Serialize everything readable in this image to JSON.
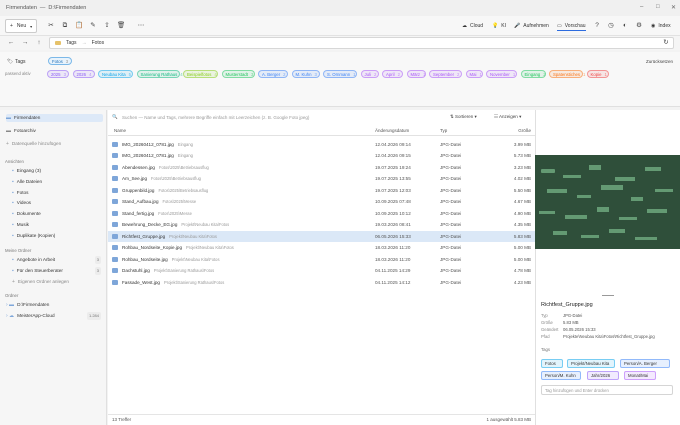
{
  "titlebar": {
    "app": "Firmendaten",
    "path": "D:\\Firmendaten"
  },
  "toolbar": {
    "new_label": "Neu",
    "cloud": "Cloud",
    "ki": "KI",
    "aufnehmen": "Aufnehmen",
    "vorschau": "Vorschau",
    "index": "Index"
  },
  "path": {
    "seg1": "Tags",
    "sep": "→",
    "seg2": "Fotos"
  },
  "tags": {
    "label": "Tags",
    "passend": "passend aktiv",
    "zuruecksetzen": "Zurücksetzen",
    "top": [
      {
        "label": "Fotos",
        "count": "3"
      }
    ],
    "chips": [
      {
        "label": "2025",
        "count": "3",
        "color": "#8b5cf6"
      },
      {
        "label": "2026",
        "count": "4",
        "color": "#8b5cf6"
      },
      {
        "label": "Neubau Kita",
        "count": "5",
        "color": "#0ea5e9"
      },
      {
        "label": "Sanierung Rathaus",
        "count": "4",
        "color": "#10b981"
      },
      {
        "label": "Beispielfotos",
        "count": "4",
        "color": "#84cc16"
      },
      {
        "label": "Musterstadt",
        "count": "3",
        "color": "#22c55e"
      },
      {
        "label": "A. Berger",
        "count": "2",
        "color": "#3b82f6"
      },
      {
        "label": "M. Kuhn",
        "count": "3",
        "color": "#3b82f6"
      },
      {
        "label": "S. Ornmann",
        "count": "1",
        "color": "#3b82f6"
      },
      {
        "label": "Juli",
        "count": "2",
        "color": "#a855f7"
      },
      {
        "label": "April",
        "count": "2",
        "color": "#a855f7"
      },
      {
        "label": "März",
        "count": "1",
        "color": "#a855f7"
      },
      {
        "label": "September",
        "count": "2",
        "color": "#a855f7"
      },
      {
        "label": "Mai",
        "count": "1",
        "color": "#a855f7"
      },
      {
        "label": "November",
        "count": "1",
        "color": "#a855f7"
      },
      {
        "label": "Eingang",
        "count": "2",
        "color": "#22c55e"
      },
      {
        "label": "Spatenstiches",
        "count": "1",
        "color": "#f97316"
      },
      {
        "label": "Kopie",
        "count": "1",
        "color": "#ef4444"
      }
    ]
  },
  "sidebar": {
    "roots": [
      {
        "label": "Firmendaten"
      },
      {
        "label": "Fotoarchiv"
      }
    ],
    "add_source": "Datenquelle hinzufügen",
    "ansichten_title": "Ansichten",
    "ansichten": [
      {
        "label": "Eingang (3)"
      },
      {
        "label": "Alle Dateien"
      },
      {
        "label": "Fotos"
      },
      {
        "label": "Videos"
      },
      {
        "label": "Dokumente"
      },
      {
        "label": "Musik"
      },
      {
        "label": "Duplikate (Kopien)"
      }
    ],
    "meine_title": "Meine Ordner",
    "meine": [
      {
        "label": "Angebote in Arbeit",
        "count": "3"
      },
      {
        "label": "Für den Steuerberater",
        "count": "3"
      }
    ],
    "add_folder": "Eigenen Ordner anlegen",
    "ordner_title": "Ordner",
    "ordner": [
      {
        "label": "D:\\Firmendaten",
        "count": ""
      },
      {
        "label": "MeisterApp-Cloud",
        "count": "1.284"
      }
    ]
  },
  "main": {
    "search_placeholder": "Suchen — Name und Tags, mehrere Begriffe einfach mit Leerzeichen (z. B. Google Foto jpeg)",
    "sort": "Sortieren",
    "view": "Anzeigen",
    "cols": {
      "name": "Name",
      "date": "Änderungsdatum",
      "type": "Typ",
      "size": "Größe"
    },
    "rows": [
      {
        "name": "IMG_20260412_0781.jpg",
        "sub": "Eingang",
        "date": "12.04.2026 09:14",
        "type": "JPG-Datei",
        "size": "3.99 MB"
      },
      {
        "name": "IMG_20260412_0781.jpg",
        "sub": "Eingang",
        "date": "12.04.2026 09:15",
        "type": "JPG-Datei",
        "size": "5.73 MB"
      },
      {
        "name": "Abendessen.jpg",
        "sub": "Fotos\\2025\\Betriebsausflug",
        "date": "19.07.2025 19:24",
        "type": "JPG-Datei",
        "size": "3.23 MB"
      },
      {
        "name": "Am_See.jpg",
        "sub": "Fotos\\2025\\Betriebsausflug",
        "date": "19.07.2025 13:55",
        "type": "JPG-Datei",
        "size": "4.02 MB"
      },
      {
        "name": "Gruppenbild.jpg",
        "sub": "Fotos\\2025\\Betriebsausflug",
        "date": "19.07.2025 12:03",
        "type": "JPG-Datei",
        "size": "5.50 MB"
      },
      {
        "name": "Stand_Aufbau.jpg",
        "sub": "Fotos\\2025\\Messe",
        "date": "10.09.2025 07:48",
        "type": "JPG-Datei",
        "size": "4.67 MB"
      },
      {
        "name": "Stand_fertig.jpg",
        "sub": "Fotos\\2025\\Messe",
        "date": "10.09.2025 10:12",
        "type": "JPG-Datei",
        "size": "4.90 MB"
      },
      {
        "name": "Bewehrung_Decke_EG.jpg",
        "sub": "Projekt\\Neubau Kita\\Fotos",
        "date": "19.03.2026 08:41",
        "type": "JPG-Datei",
        "size": "4.35 MB"
      },
      {
        "name": "Richtfest_Gruppe.jpg",
        "sub": "Projekt\\Neubau Kita\\Fotos",
        "date": "06.05.2026 15:33",
        "type": "JPG-Datei",
        "size": "5.83 MB"
      },
      {
        "name": "Rohbau_Nordseite_Kopie.jpg",
        "sub": "Projekt\\Neubau Kita\\Fotos",
        "date": "18.03.2026 11:20",
        "type": "JPG-Datei",
        "size": "5.00 MB"
      },
      {
        "name": "Rohbau_Nordseite.jpg",
        "sub": "Projekt\\Neubau Kita\\Fotos",
        "date": "18.03.2026 11:20",
        "type": "JPG-Datei",
        "size": "5.00 MB"
      },
      {
        "name": "Dachstuhl.jpg",
        "sub": "Projekt\\Sanierung Rathaus\\Fotos",
        "date": "04.11.2025 14:29",
        "type": "JPG-Datei",
        "size": "4.78 MB"
      },
      {
        "name": "Fassade_West.jpg",
        "sub": "Projekt\\Sanierung Rathaus\\Fotos",
        "date": "04.11.2025 14:12",
        "type": "JPG-Datei",
        "size": "4.23 MB"
      }
    ],
    "status_left": "13 Treffer",
    "status_right": "1 ausgewählt 5.83 MB"
  },
  "preview": {
    "filename": "Richtfest_Gruppe.jpg",
    "details": [
      {
        "k": "Typ",
        "v": "JPG-Datei"
      },
      {
        "k": "Größe",
        "v": "5.83 MB"
      },
      {
        "k": "Geändert",
        "v": "06.05.2026 15:33"
      },
      {
        "k": "Pfad",
        "v": "Projekte\\Neubau Kita\\Fotos\\Richtfest_Gruppe.jpg"
      }
    ],
    "tags_title": "Tags",
    "tags": [
      {
        "label": "Fotos",
        "color": "#0ea5e9"
      },
      {
        "label": "Projekt/Neubau Kita",
        "color": "#0ea5e9"
      },
      {
        "label": "Person/A. Berger",
        "color": "#3b82f6"
      },
      {
        "label": "Person/M. Kuhn",
        "color": "#3b82f6"
      },
      {
        "label": "Jahr/2026",
        "color": "#8b5cf6"
      },
      {
        "label": "Monat/Mai",
        "color": "#a855f7"
      }
    ],
    "tag_input_placeholder": "Tag hinzufügen und Enter drücken"
  },
  "accent": "#2d6cdf"
}
